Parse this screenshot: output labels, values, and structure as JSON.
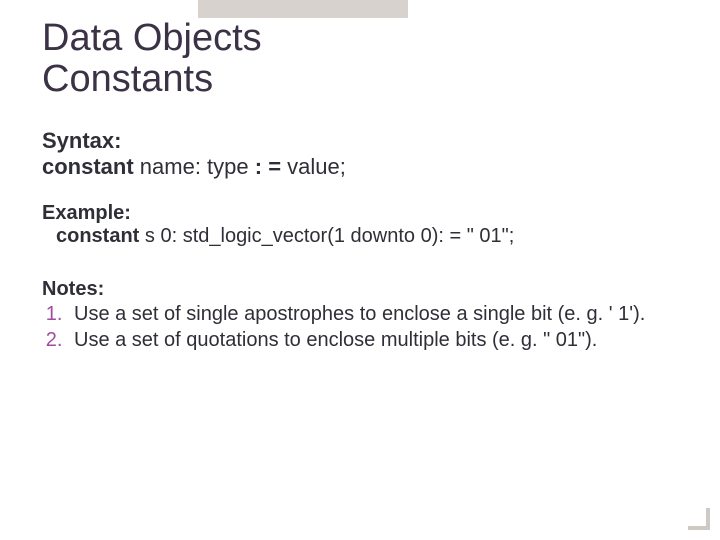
{
  "title_line1": "Data Objects",
  "title_line2": "Constants",
  "syntax": {
    "header": "Syntax:",
    "keyword": "constant",
    "middle": "  name: type ",
    "assign": ": =",
    "tail": "  value;"
  },
  "example": {
    "header": "Example:",
    "keyword": "constant",
    "body": " s 0: std_logic_vector(1 downto 0): = \" 01\";"
  },
  "notes": {
    "header": "Notes:",
    "items": [
      "Use  a set of single apostrophes to enclose a single bit (e. g. ' 1').",
      "Use a set of quotations to enclose multiple bits (e. g. \" 01\")."
    ]
  }
}
